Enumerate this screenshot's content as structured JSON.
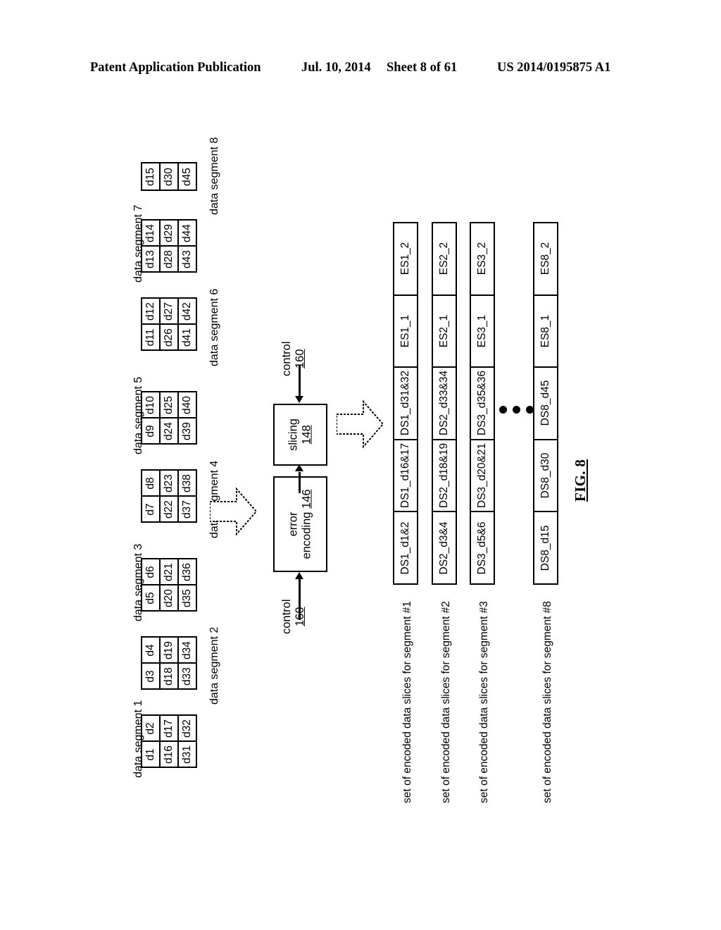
{
  "header": {
    "publication": "Patent Application Publication",
    "date": "Jul. 10, 2014",
    "sheet": "Sheet 8 of 61",
    "number": "US 2014/0195875 A1"
  },
  "figure": {
    "label": "FIG. 8"
  },
  "data_segments": [
    {
      "label": "data segment 1",
      "rows": [
        [
          "d1",
          "d2"
        ],
        [
          "d16",
          "d17"
        ],
        [
          "d31",
          "d32"
        ]
      ]
    },
    {
      "label": "data segment 2",
      "rows": [
        [
          "d3",
          "d4"
        ],
        [
          "d18",
          "d19"
        ],
        [
          "d33",
          "d34"
        ]
      ]
    },
    {
      "label": "data segment 3",
      "rows": [
        [
          "d5",
          "d6"
        ],
        [
          "d20",
          "d21"
        ],
        [
          "d35",
          "d36"
        ]
      ]
    },
    {
      "label": "data segment 4",
      "rows": [
        [
          "d7",
          "d8"
        ],
        [
          "d22",
          "d23"
        ],
        [
          "d37",
          "d38"
        ]
      ]
    },
    {
      "label": "data segment 5",
      "rows": [
        [
          "d9",
          "d10"
        ],
        [
          "d24",
          "d25"
        ],
        [
          "d39",
          "d40"
        ]
      ]
    },
    {
      "label": "data segment 6",
      "rows": [
        [
          "d11",
          "d12"
        ],
        [
          "d26",
          "d27"
        ],
        [
          "d41",
          "d42"
        ]
      ]
    },
    {
      "label": "data segment 7",
      "rows": [
        [
          "d13",
          "d14"
        ],
        [
          "d28",
          "d29"
        ],
        [
          "d43",
          "d44"
        ]
      ]
    },
    {
      "label": "data segment 8",
      "rows": [
        [
          "d15"
        ],
        [
          "d30"
        ],
        [
          "d45"
        ]
      ]
    }
  ],
  "process": {
    "error_encoding": {
      "line1": "error",
      "line2": "encoding",
      "ref": "146"
    },
    "slicing": {
      "line1": "slicing",
      "ref": "148"
    },
    "control_in": {
      "text": "control",
      "ref": "160"
    },
    "control_slicing": {
      "text": "control",
      "ref": "160"
    }
  },
  "slice_sets": [
    {
      "label": "set of encoded data slices for segment #1",
      "cells": [
        "DS1_d1&2",
        "DS1_d16&17",
        "DS1_d31&32",
        "ES1_1",
        "ES1_2"
      ]
    },
    {
      "label": "set of encoded data slices for segment #2",
      "cells": [
        "DS2_d3&4",
        "DS2_d18&19",
        "DS2_d33&34",
        "ES2_1",
        "ES2_2"
      ]
    },
    {
      "label": "set of encoded data slices for segment #3",
      "cells": [
        "DS3_d5&6",
        "DS3_d20&21",
        "DS3_d35&36",
        "ES3_1",
        "ES3_2"
      ]
    },
    {
      "label": "set of encoded data slices for segment #8",
      "cells": [
        "DS8_d15",
        "DS8_d30",
        "DS8_d45",
        "ES8_1",
        "ES8_2"
      ]
    }
  ],
  "ellipsis": "•••"
}
